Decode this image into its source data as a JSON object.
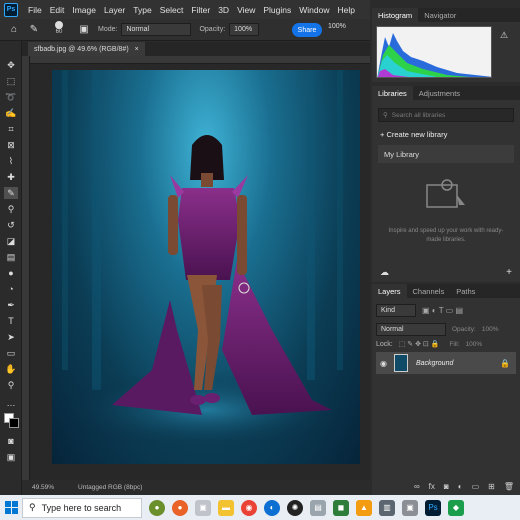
{
  "menu": [
    "File",
    "Edit",
    "Image",
    "Layer",
    "Type",
    "Select",
    "Filter",
    "3D",
    "View",
    "Plugins",
    "Window",
    "Help"
  ],
  "app_logo": "Ps",
  "options": {
    "brush_size": "60",
    "mode_label": "Mode:",
    "mode_value": "Normal",
    "opacity_label": "Opacity:",
    "opacity_value": "100%",
    "share_label": "Share",
    "zoom_value": "100%"
  },
  "document_tab": {
    "title": "sfbadb.jpg @ 49.6% (RGB/8#)",
    "close": "×"
  },
  "status": {
    "zoom": "49.59%",
    "profile": "Untagged RGB (8bpc)"
  },
  "panels": {
    "histogram_tabs": [
      "Histogram",
      "Navigator"
    ],
    "libraries_tabs": [
      "Libraries",
      "Adjustments"
    ],
    "search_placeholder": "Search all libraries",
    "create_library": "Create new library",
    "my_library": "My Library",
    "library_hint": "Inspire and speed up your work with ready-made libraries.",
    "layers_tabs": [
      "Layers",
      "Channels",
      "Paths"
    ],
    "layer_filter": "Kind",
    "blend_mode": "Normal",
    "layer_opacity_label": "Opacity:",
    "layer_opacity": "100%",
    "lock_label": "Lock:",
    "fill_label": "Fill:",
    "fill_value": "100%",
    "layer_name": "Background"
  },
  "taskbar": {
    "search_text": "Type here to search"
  }
}
